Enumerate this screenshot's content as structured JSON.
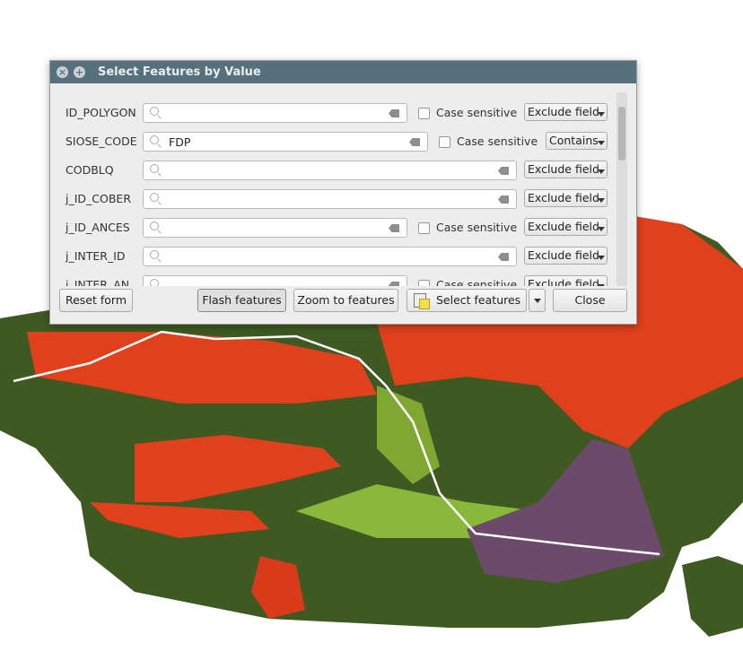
{
  "dialog": {
    "title": "Select Features by Value",
    "fields": [
      {
        "name": "ID_POLYGON",
        "value": "",
        "case_sensitive": "Case sensitive",
        "mode": "Exclude field"
      },
      {
        "name": "SIOSE_CODE",
        "value": "FDP",
        "case_sensitive": "Case sensitive",
        "mode": "Contains"
      },
      {
        "name": "CODBLQ",
        "value": "",
        "mode": "Exclude field"
      },
      {
        "name": "j_ID_COBER",
        "value": "",
        "mode": "Exclude field"
      },
      {
        "name": "j_ID_ANCES",
        "value": "",
        "case_sensitive": "Case sensitive",
        "mode": "Exclude field"
      },
      {
        "name": "j_INTER_ID",
        "value": "",
        "mode": "Exclude field"
      },
      {
        "name": "j_INTER_AN",
        "value": "",
        "case_sensitive": "Case sensitive",
        "mode": "Exclude field"
      }
    ],
    "buttons": {
      "reset": "Reset form",
      "flash": "Flash features",
      "zoom": "Zoom to features",
      "select": "Select features",
      "close": "Close"
    }
  },
  "map": {
    "colors": {
      "forest": "#3e5a22",
      "red": "#e0401c",
      "light_green": "#8ab83a",
      "purple": "#6b4a6a",
      "route": "#ffffff"
    }
  }
}
